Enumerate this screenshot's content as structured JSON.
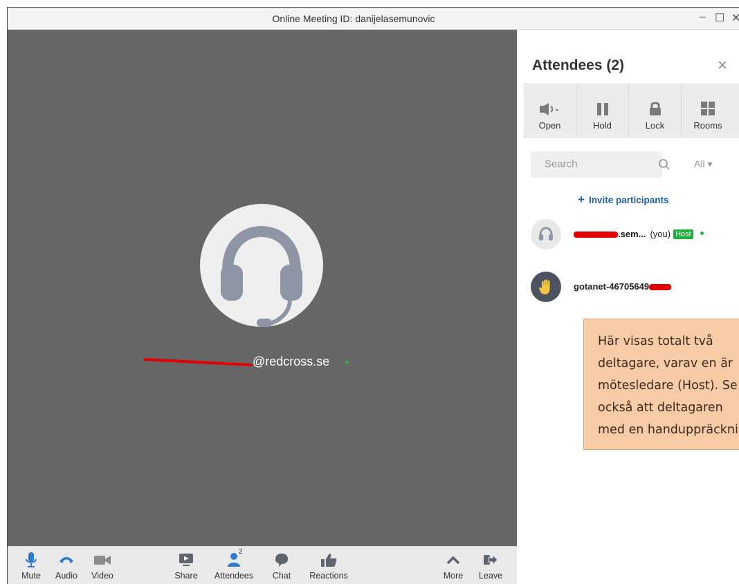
{
  "window": {
    "title": "Online Meeting ID: danijelasemunovic",
    "controls": {
      "minimize": "–",
      "maximize": "☐",
      "close": "✕"
    }
  },
  "stage": {
    "participant_email_suffix": "@redcross.se",
    "status_color": "#2db34a"
  },
  "toolbar": {
    "mute": "Mute",
    "audio": "Audio",
    "video": "Video",
    "share": "Share",
    "attendees": "Attendees",
    "attendees_badge": "2",
    "chat": "Chat",
    "reactions": "Reactions",
    "more": "More",
    "leave": "Leave"
  },
  "panel": {
    "title": "Attendees (2)",
    "close": "×",
    "actions": {
      "open": "Open",
      "hold": "Hold",
      "lock": "Lock",
      "rooms": "Rooms"
    },
    "search_placeholder": "Search",
    "filter": "All ▾",
    "invite": "Invite participants",
    "invite_plus": "+",
    "attendees": [
      {
        "name_suffix": ".sem...",
        "you": "(you)",
        "role": "Host",
        "icon": "headset-icon"
      },
      {
        "name_prefix": "gotanet-46705649",
        "icon": "raised-hand-icon"
      }
    ]
  },
  "callout": {
    "lines": [
      "Här visas totalt två",
      "deltagare, varav en är",
      "mötesledare (Host). Se",
      "också att deltagaren",
      "med en handuppräckning"
    ]
  },
  "colors": {
    "accent_blue": "#1f5fa0",
    "host_green": "#1fae3f",
    "stage_gray": "#666666",
    "callout_bg": "#f8cba7"
  }
}
